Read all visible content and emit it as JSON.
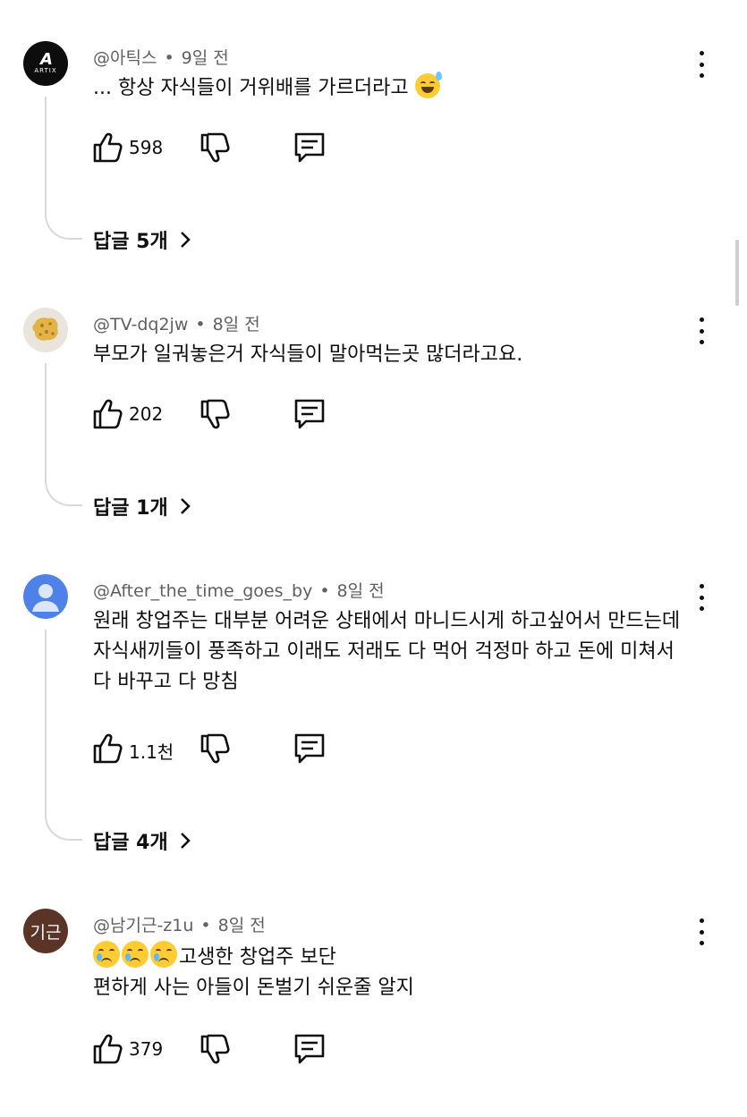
{
  "comments": [
    {
      "handle": "@아틱스",
      "time": "9일 전",
      "avatar_text": "ARTIX",
      "text": "... 항상 자식들이 거위배를 가르더라고",
      "emoji": "sweat-smile-emoji",
      "likes": "598",
      "replies": "답글 5개"
    },
    {
      "handle": "@TV-dq2jw",
      "time": "8일 전",
      "text": "부모가 일궈놓은거 자식들이 말아먹는곳 많더라고요.",
      "likes": "202",
      "replies": "답글 1개"
    },
    {
      "handle": "@After_the_time_goes_by",
      "time": "8일 전",
      "text": "원래 창업주는 대부분 어려운 상태에서 마니드시게 하고싶어서 만드는데 자식새끼들이 풍족하고 이래도 저래도 다 먹어 걱정마 하고 돈에 미쳐서 다 바꾸고 다 망침",
      "likes": "1.1천",
      "replies": "답글 4개"
    },
    {
      "handle": "@남기근-z1u",
      "time": "8일 전",
      "avatar_text": "기근",
      "emoji": "crying-face-emoji",
      "text_line1": "고생한 창업주 보단",
      "text_line2": "편하게 사는 아들이 돈벌기 쉬운줄 알지",
      "likes": "379"
    }
  ],
  "dot": "•"
}
